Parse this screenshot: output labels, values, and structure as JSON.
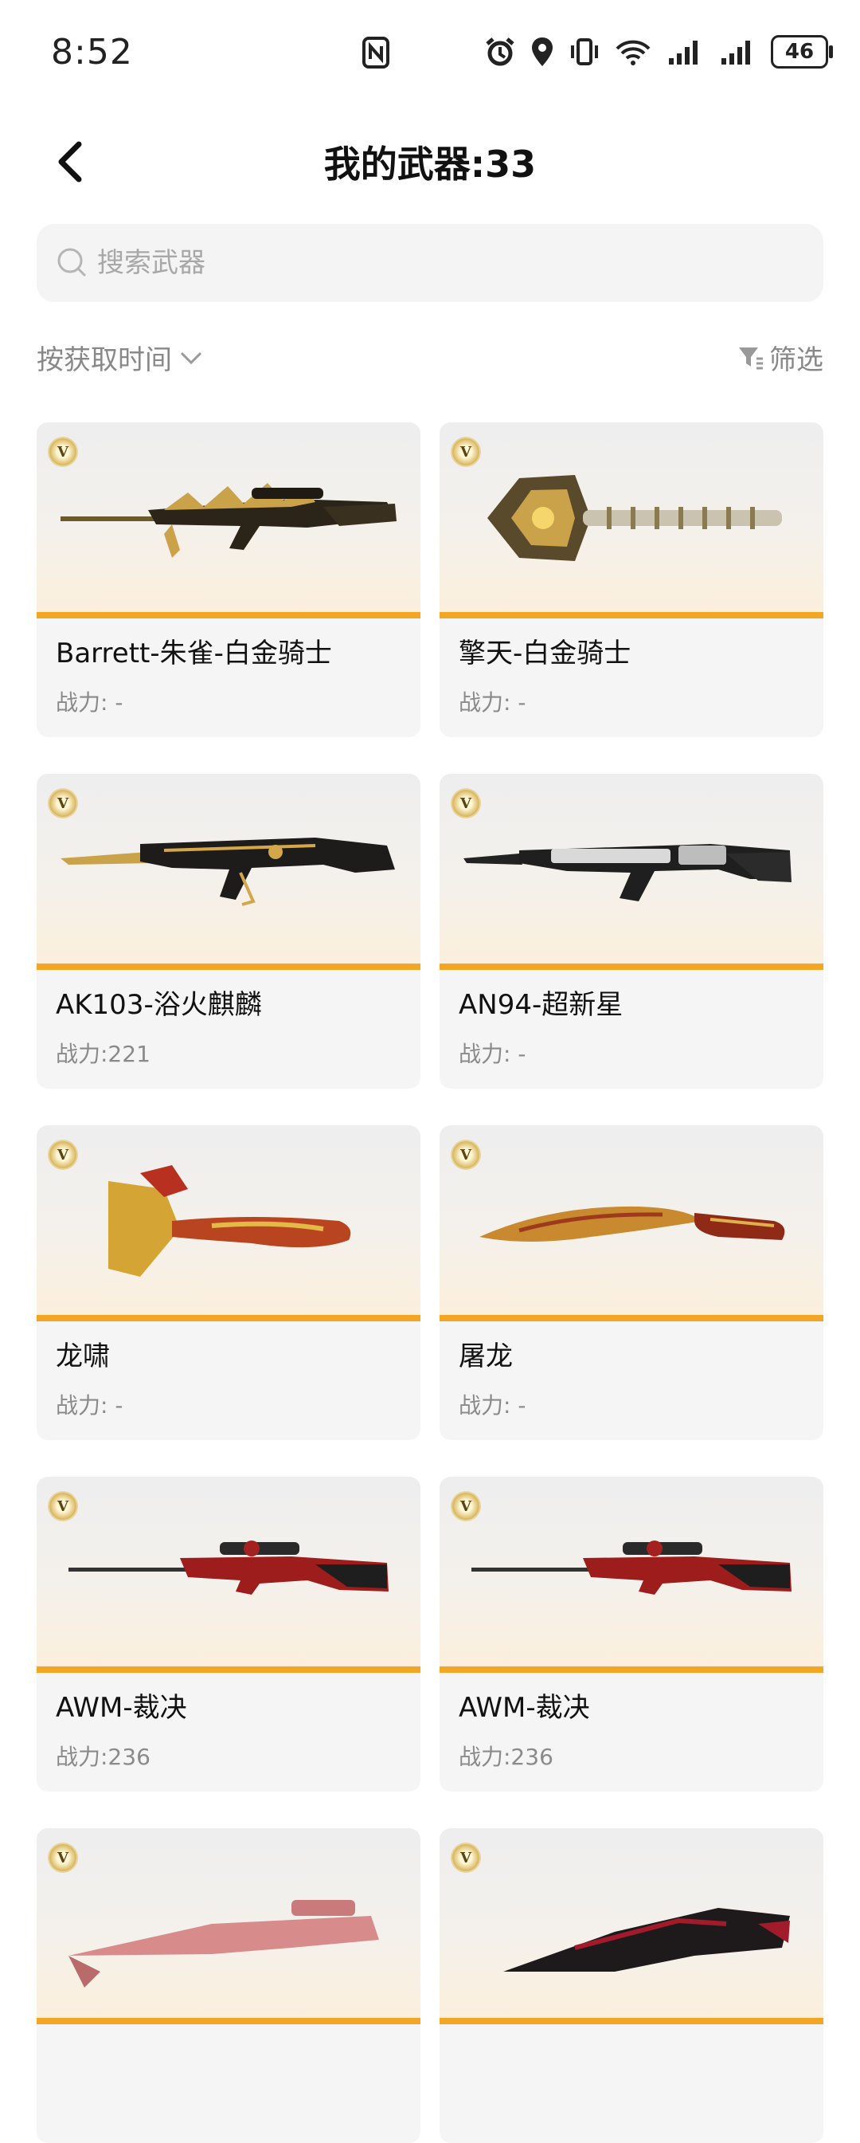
{
  "status_bar": {
    "time": "8:52",
    "battery": "46",
    "signal_5g": "6"
  },
  "header": {
    "title": "我的武器:33"
  },
  "search": {
    "placeholder": "搜索武器"
  },
  "sort": {
    "label": "按获取时间",
    "filter_label": "筛选"
  },
  "weapons": [
    {
      "name": "Barrett-朱雀-白金骑士",
      "power": "战力: -",
      "image": "gold-sniper-rifle"
    },
    {
      "name": "擎天-白金骑士",
      "power": "战力: -",
      "image": "gold-heavy-weapon"
    },
    {
      "name": "AK103-浴火麒麟",
      "power": "战力:221",
      "image": "black-gold-assault-rifle"
    },
    {
      "name": "AN94-超新星",
      "power": "战力: -",
      "image": "silver-assault-rifle"
    },
    {
      "name": "龙啸",
      "power": "战力: -",
      "image": "gold-dragon-axe"
    },
    {
      "name": "屠龙",
      "power": "战力: -",
      "image": "red-gold-kukri"
    },
    {
      "name": "AWM-裁决",
      "power": "战力:236",
      "image": "red-sniper-rifle"
    },
    {
      "name": "AWM-裁决",
      "power": "战力:236",
      "image": "red-sniper-rifle"
    },
    {
      "name": "",
      "power": "",
      "image": "pink-sniper-rifle"
    },
    {
      "name": "",
      "power": "",
      "image": "black-red-rifle"
    }
  ],
  "colors": {
    "accent": "#f2a623",
    "card_bg": "#f5f5f5",
    "muted_text": "#8a8a8a"
  }
}
